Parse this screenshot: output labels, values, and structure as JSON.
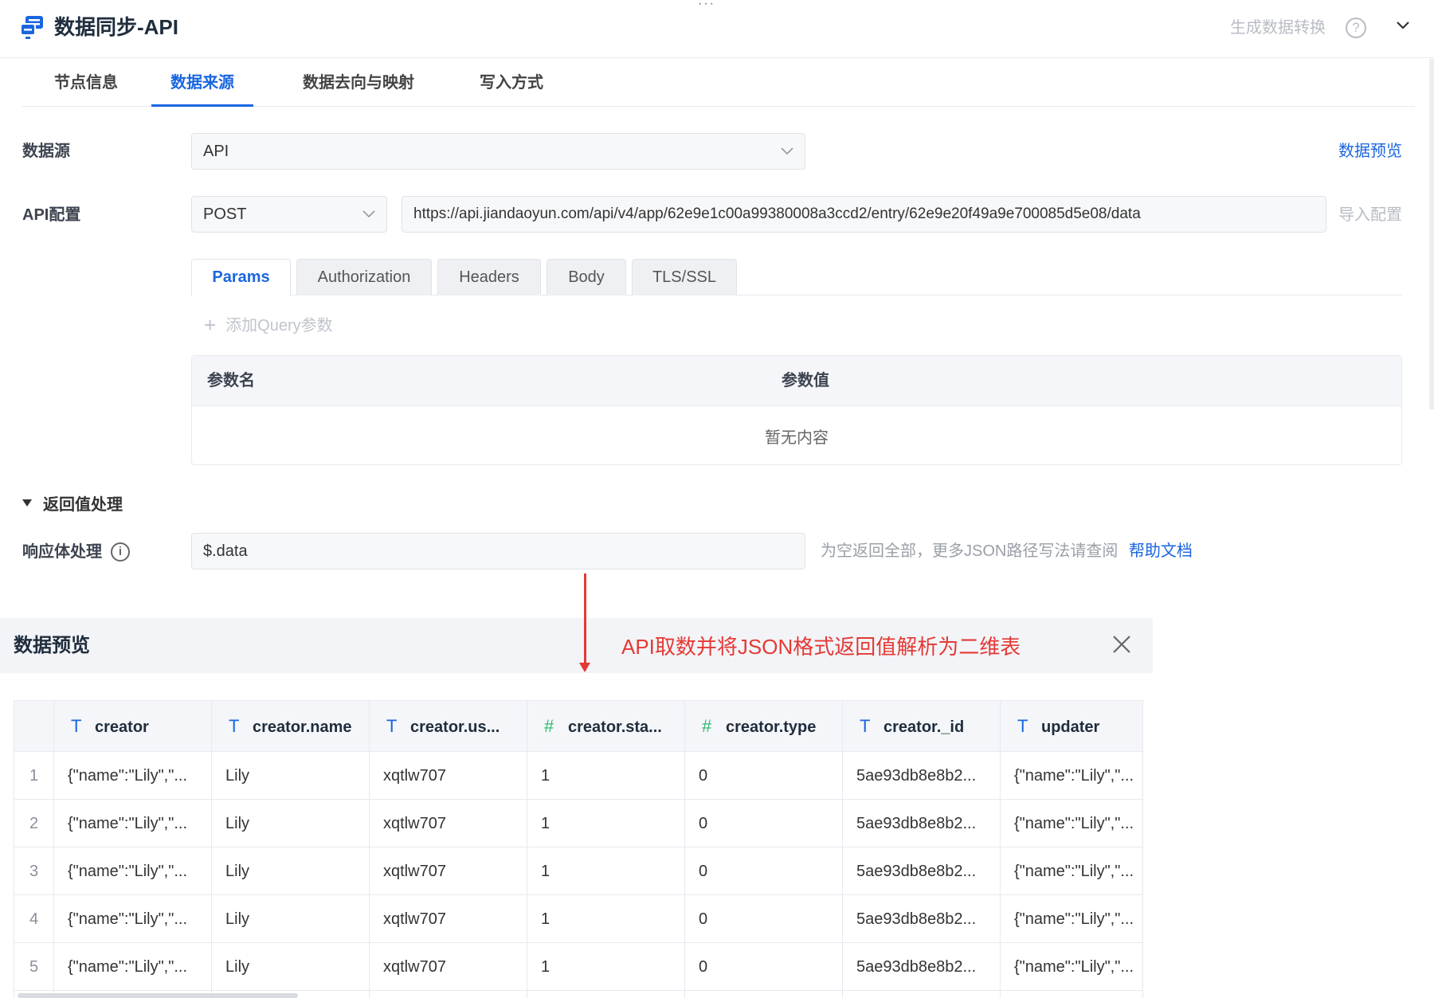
{
  "header": {
    "title": "数据同步-API",
    "more": "···",
    "generate_convert": "生成数据转换",
    "help": "?"
  },
  "tabs": [
    {
      "label": "节点信息",
      "active": false
    },
    {
      "label": "数据来源",
      "active": true
    },
    {
      "label": "数据去向与映射",
      "active": false
    },
    {
      "label": "写入方式",
      "active": false
    }
  ],
  "datasource": {
    "label": "数据源",
    "value": "API",
    "preview_link": "数据预览"
  },
  "api_config": {
    "label": "API配置",
    "method": "POST",
    "url": "https://api.jiandaoyun.com/api/v4/app/62e9e1c00a99380008a3ccd2/entry/62e9e20f49a9e700085d5e08/data",
    "import_link": "导入配置"
  },
  "subtabs": [
    {
      "label": "Params",
      "active": true
    },
    {
      "label": "Authorization",
      "active": false
    },
    {
      "label": "Headers",
      "active": false
    },
    {
      "label": "Body",
      "active": false
    },
    {
      "label": "TLS/SSL",
      "active": false
    }
  ],
  "params": {
    "add_label": "添加Query参数",
    "col_name": "参数名",
    "col_value": "参数值",
    "empty": "暂无内容"
  },
  "response": {
    "section_title": "返回值处理",
    "label": "响应体处理",
    "value": "$.data",
    "hint": "为空返回全部，更多JSON路径写法请查阅",
    "help_link": "帮助文档"
  },
  "preview": {
    "title": "数据预览",
    "annotation": "API取数并将JSON格式返回值解析为二维表",
    "columns": [
      {
        "name": "creator",
        "type": "text"
      },
      {
        "name": "creator.name",
        "type": "text"
      },
      {
        "name": "creator.us...",
        "type": "text"
      },
      {
        "name": "creator.sta...",
        "type": "number"
      },
      {
        "name": "creator.type",
        "type": "number"
      },
      {
        "name": "creator._id",
        "type": "text"
      },
      {
        "name": "updater",
        "type": "text"
      }
    ],
    "rows": [
      {
        "n": "1",
        "c": [
          "{\"name\":\"Lily\",\"...",
          "Lily",
          "xqtlw707",
          "1",
          "0",
          "5ae93db8e8b2...",
          "{\"name\":\"Lily\",\"..."
        ]
      },
      {
        "n": "2",
        "c": [
          "{\"name\":\"Lily\",\"...",
          "Lily",
          "xqtlw707",
          "1",
          "0",
          "5ae93db8e8b2...",
          "{\"name\":\"Lily\",\"..."
        ]
      },
      {
        "n": "3",
        "c": [
          "{\"name\":\"Lily\",\"...",
          "Lily",
          "xqtlw707",
          "1",
          "0",
          "5ae93db8e8b2...",
          "{\"name\":\"Lily\",\"..."
        ]
      },
      {
        "n": "4",
        "c": [
          "{\"name\":\"Lily\",\"...",
          "Lily",
          "xqtlw707",
          "1",
          "0",
          "5ae93db8e8b2...",
          "{\"name\":\"Lily\",\"..."
        ]
      },
      {
        "n": "5",
        "c": [
          "{\"name\":\"Lily\",\"...",
          "Lily",
          "xqtlw707",
          "1",
          "0",
          "5ae93db8e8b2...",
          "{\"name\":\"Lily\",\"..."
        ]
      }
    ]
  },
  "colors": {
    "accent": "#1a66e0",
    "annotation": "#e53935",
    "number_type": "#2eb872"
  }
}
